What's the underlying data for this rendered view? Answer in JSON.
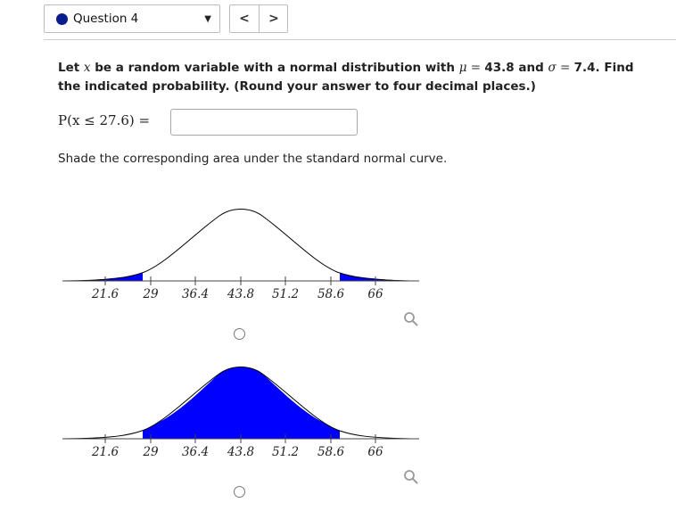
{
  "header": {
    "question_label": "Question 4",
    "prev_label": "<",
    "next_label": ">",
    "dropdown_glyph": "▼"
  },
  "question": {
    "intro": "Let ",
    "var": "x",
    "mid1": " be a random variable with a normal distribution with ",
    "mu_symbol": "μ",
    "equals1": " = ",
    "mu_value": "43.8",
    "and": " and ",
    "sigma_symbol": "σ",
    "equals2": " = ",
    "sigma_value": "7.4",
    "tail": ". Find the indicated probability. (Round your answer to four decimal places.)"
  },
  "answer": {
    "label": "P(x ≤ 27.6) =",
    "value": "",
    "placeholder": ""
  },
  "instruction": "Shade the corresponding area under the standard normal curve.",
  "options": [
    {
      "id": "option-1",
      "shading": "tails",
      "ticks": [
        "21.6",
        "29",
        "36.4",
        "43.8",
        "51.2",
        "58.6",
        "66"
      ],
      "selected": false
    },
    {
      "id": "option-2",
      "shading": "middle",
      "ticks": [
        "21.6",
        "29",
        "36.4",
        "43.8",
        "51.2",
        "58.6",
        "66"
      ],
      "selected": false
    }
  ],
  "colors": {
    "shade": "#0000ff",
    "accent": "#0b1d8c"
  },
  "icons": {
    "zoom": "magnifier-icon",
    "status": "circle-dot-icon"
  }
}
